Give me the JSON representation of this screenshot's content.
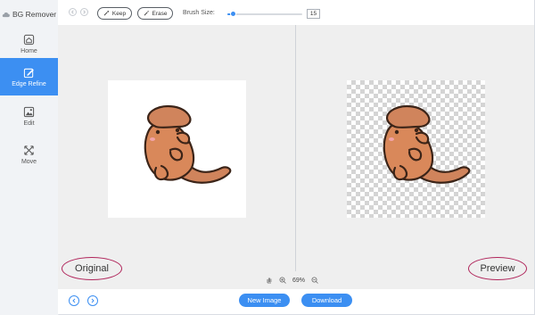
{
  "app": {
    "title": "BG Remover",
    "logo_icon": "cloud-logo-icon"
  },
  "sidebar": {
    "items": [
      {
        "label": "Home",
        "icon": "home-icon",
        "active": false
      },
      {
        "label": "Edge Refine",
        "icon": "edit-square-icon",
        "active": true
      },
      {
        "label": "Edit",
        "icon": "image-edit-icon",
        "active": false
      },
      {
        "label": "Move",
        "icon": "move-arrows-icon",
        "active": false
      }
    ]
  },
  "toolbar": {
    "undo_icon": "undo-icon",
    "redo_icon": "redo-icon",
    "keep_label": "Keep",
    "erase_label": "Erase",
    "brush_size_label": "Brush Size:",
    "brush_size_value": "15",
    "brush_size_fraction": 0.08
  },
  "workspace": {
    "original_label": "Original",
    "preview_label": "Preview",
    "zoom_level": "69%",
    "zoom_icons": [
      "hand-icon",
      "zoom-in-icon",
      "zoom-out-icon"
    ]
  },
  "footer": {
    "new_image_label": "New Image",
    "download_label": "Download"
  },
  "colors": {
    "accent": "#3c8ff2",
    "annotation": "#b0245a",
    "subject": "#d9885a"
  }
}
